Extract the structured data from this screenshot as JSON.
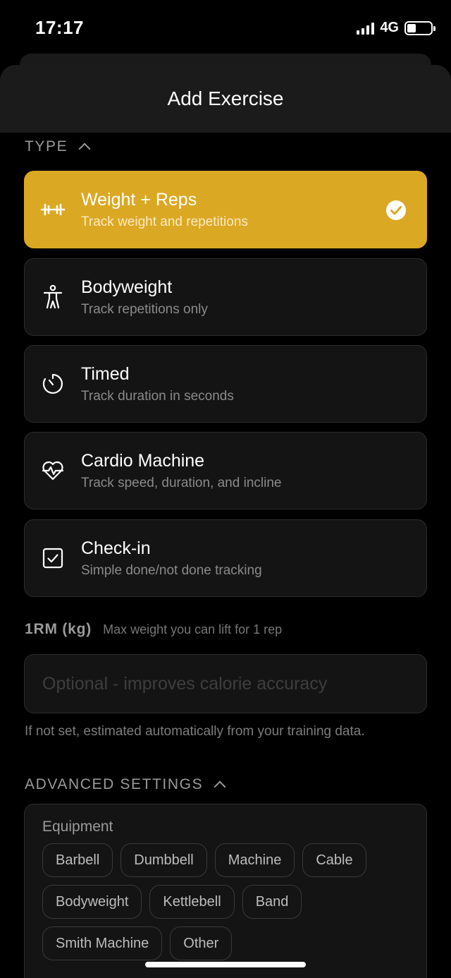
{
  "status": {
    "time": "17:17",
    "network": "4G"
  },
  "header": {
    "title": "Add Exercise"
  },
  "type_section": {
    "label": "TYPE",
    "options": [
      {
        "title": "Weight + Reps",
        "subtitle": "Track weight and repetitions",
        "icon": "dumbbell-icon",
        "selected": true
      },
      {
        "title": "Bodyweight",
        "subtitle": "Track repetitions only",
        "icon": "person-icon",
        "selected": false
      },
      {
        "title": "Timed",
        "subtitle": "Track duration in seconds",
        "icon": "stopwatch-icon",
        "selected": false
      },
      {
        "title": "Cardio Machine",
        "subtitle": "Track speed, duration, and incline",
        "icon": "heart-pulse-icon",
        "selected": false
      },
      {
        "title": "Check-in",
        "subtitle": "Simple done/not done tracking",
        "icon": "checkbox-icon",
        "selected": false
      }
    ]
  },
  "one_rm": {
    "label": "1RM (kg)",
    "hint": "Max weight you can lift for 1 rep",
    "value": "",
    "placeholder": "Optional - improves calorie accuracy",
    "note": "If not set, estimated automatically from your training data."
  },
  "advanced": {
    "label": "ADVANCED SETTINGS",
    "equipment_label": "Equipment",
    "equipment": [
      "Barbell",
      "Dumbbell",
      "Machine",
      "Cable",
      "Bodyweight",
      "Kettlebell",
      "Band",
      "Smith Machine",
      "Other"
    ]
  },
  "colors": {
    "accent": "#dba824",
    "card": "#141414",
    "border": "#2c2c2c"
  }
}
